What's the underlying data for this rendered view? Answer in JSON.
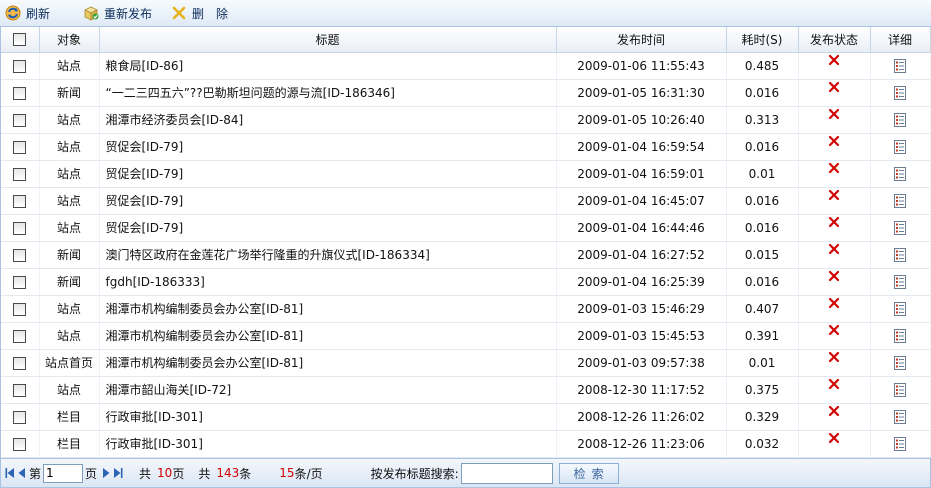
{
  "toolbar": {
    "refresh_label": "刷新",
    "republish_label": "重新发布",
    "delete_label": "删　除"
  },
  "table": {
    "columns": [
      "对象",
      "标题",
      "发布时间",
      "耗时(S)",
      "发布状态",
      "详细"
    ],
    "rows": [
      {
        "object": "站点",
        "title": "粮食局[ID-86]",
        "time": "2009-01-06 11:55:43",
        "cost": "0.485"
      },
      {
        "object": "新闻",
        "title": "“一二三四五六”??巴勒斯坦问题的源与流[ID-186346]",
        "time": "2009-01-05 16:31:30",
        "cost": "0.016"
      },
      {
        "object": "站点",
        "title": "湘潭市经济委员会[ID-84]",
        "time": "2009-01-05 10:26:40",
        "cost": "0.313"
      },
      {
        "object": "站点",
        "title": "贸促会[ID-79]",
        "time": "2009-01-04 16:59:54",
        "cost": "0.016"
      },
      {
        "object": "站点",
        "title": "贸促会[ID-79]",
        "time": "2009-01-04 16:59:01",
        "cost": "0.01"
      },
      {
        "object": "站点",
        "title": "贸促会[ID-79]",
        "time": "2009-01-04 16:45:07",
        "cost": "0.016"
      },
      {
        "object": "站点",
        "title": "贸促会[ID-79]",
        "time": "2009-01-04 16:44:46",
        "cost": "0.016"
      },
      {
        "object": "新闻",
        "title": "澳门特区政府在金莲花广场举行隆重的升旗仪式[ID-186334]",
        "time": "2009-01-04 16:27:52",
        "cost": "0.015"
      },
      {
        "object": "新闻",
        "title": "fgdh[ID-186333]",
        "time": "2009-01-04 16:25:39",
        "cost": "0.016"
      },
      {
        "object": "站点",
        "title": "湘潭市机构编制委员会办公室[ID-81]",
        "time": "2009-01-03 15:46:29",
        "cost": "0.407"
      },
      {
        "object": "站点",
        "title": "湘潭市机构编制委员会办公室[ID-81]",
        "time": "2009-01-03 15:45:53",
        "cost": "0.391"
      },
      {
        "object": "站点首页",
        "title": "湘潭市机构编制委员会办公室[ID-81]",
        "time": "2009-01-03 09:57:38",
        "cost": "0.01"
      },
      {
        "object": "站点",
        "title": "湘潭市韶山海关[ID-72]",
        "time": "2008-12-30 11:17:52",
        "cost": "0.375"
      },
      {
        "object": "栏目",
        "title": "行政审批[ID-301]",
        "time": "2008-12-26 11:26:02",
        "cost": "0.329"
      },
      {
        "object": "栏目",
        "title": "行政审批[ID-301]",
        "time": "2008-12-26 11:23:06",
        "cost": "0.032"
      }
    ],
    "status_icon": "red-x-icon",
    "detail_icon": "document-detail-icon"
  },
  "pager": {
    "page_prefix": "第",
    "page_value": "1",
    "page_suffix": "页",
    "total_pages_prefix": "共",
    "total_pages": "10",
    "total_pages_suffix": "页",
    "total_items_prefix": "共",
    "total_items": "143",
    "total_items_suffix": "条",
    "page_size": "15",
    "page_size_suffix": "条/页",
    "search_label": "按发布标题搜索:",
    "search_value": "",
    "search_button": "检索"
  },
  "colors": {
    "toolbar_bg": "#dfe9f6",
    "border": "#a9c3e1",
    "status_red": "#d10000",
    "accent_text": "#0b2c5a"
  }
}
